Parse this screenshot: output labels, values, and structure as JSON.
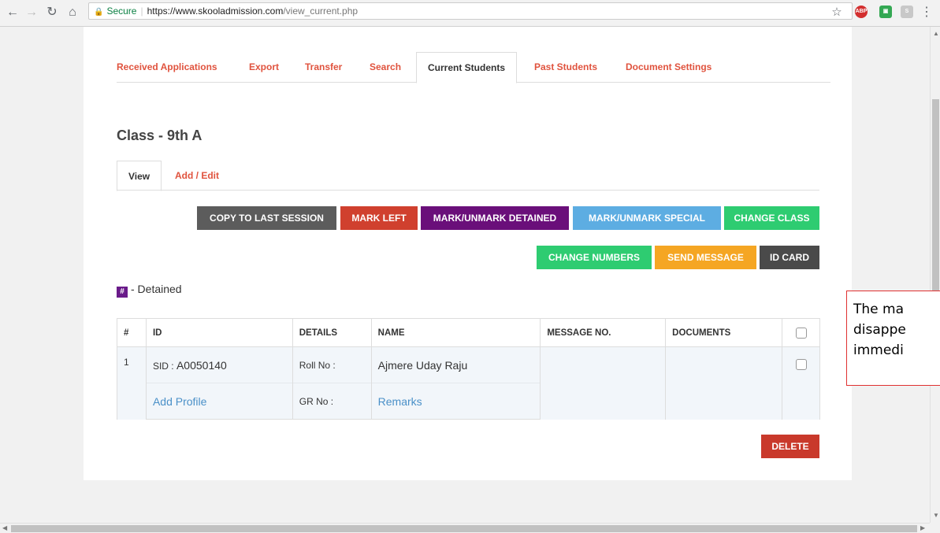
{
  "browser": {
    "secure_label": "Secure",
    "url_domain": "https://www.skooladmission.com",
    "url_path": "/view_current.php"
  },
  "top_tabs": [
    {
      "label": "Received Applications"
    },
    {
      "label": "Export"
    },
    {
      "label": "Transfer"
    },
    {
      "label": "Search"
    },
    {
      "label": "Current Students"
    },
    {
      "label": "Past Students"
    },
    {
      "label": "Document Settings"
    }
  ],
  "page_title": "Class - 9th A",
  "sub_tabs": [
    {
      "label": "View"
    },
    {
      "label": "Add / Edit"
    }
  ],
  "actions": {
    "copy_last_session": "COPY TO LAST SESSION",
    "mark_left": "MARK LEFT",
    "mark_detained": "MARK/UNMARK DETAINED",
    "mark_special": "MARK/UNMARK SPECIAL",
    "change_class": "CHANGE CLASS",
    "change_numbers": "CHANGE NUMBERS",
    "send_message": "SEND MESSAGE",
    "id_card": "ID CARD",
    "delete": "DELETE"
  },
  "legend": {
    "mark": "#",
    "text": "- Detained"
  },
  "table": {
    "headers": [
      "#",
      "ID",
      "DETAILS",
      "NAME",
      "MESSAGE NO.",
      "DOCUMENTS"
    ],
    "rows": [
      {
        "num": "1",
        "sid_prefix": "SID : ",
        "sid": "A0050140",
        "roll_label": "Roll No :",
        "name": "Ajmere Uday Raju",
        "add_profile": "Add Profile",
        "gr_label": "GR No :",
        "remarks": "Remarks"
      }
    ]
  },
  "callout": {
    "line1": "The ma",
    "line2": "disappe",
    "line3": "immedi"
  },
  "colors": {
    "accent": "#e0533e",
    "copy": "#5c5c5c",
    "mark_left": "#d0402e",
    "detained": "#6a0f7a",
    "special": "#5dade2",
    "change": "#2ecc71",
    "send": "#f5a623",
    "id_card": "#4a4a4a",
    "delete": "#c9392b"
  }
}
